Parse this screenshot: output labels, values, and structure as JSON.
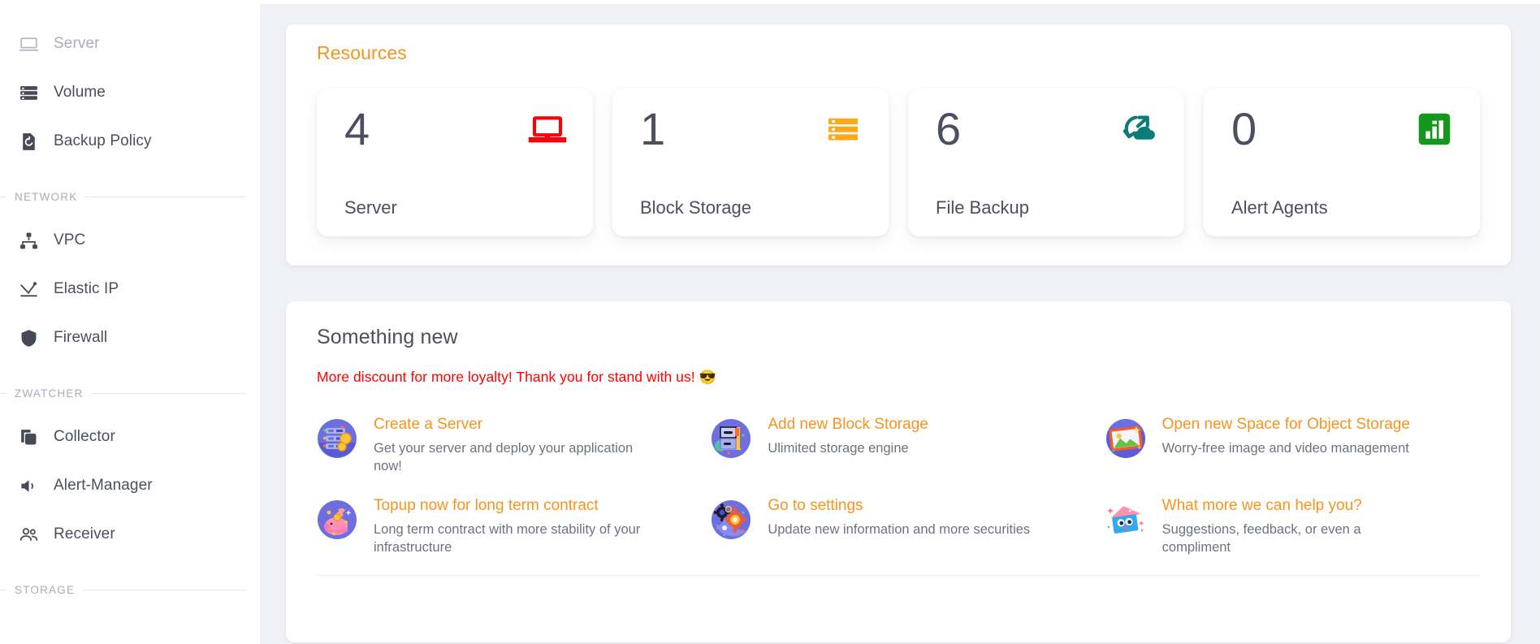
{
  "sidebar": {
    "items": [
      {
        "type": "item",
        "label": "Server",
        "icon": "laptop-icon",
        "muted": true
      },
      {
        "type": "item",
        "label": "Volume",
        "icon": "server-stack-icon",
        "muted": false
      },
      {
        "type": "item",
        "label": "Backup Policy",
        "icon": "backup-restore-icon",
        "muted": false
      },
      {
        "type": "group",
        "label": "NETWORK"
      },
      {
        "type": "item",
        "label": "VPC",
        "icon": "network-topology-icon",
        "muted": false
      },
      {
        "type": "item",
        "label": "Elastic IP",
        "icon": "elastic-ip-icon",
        "muted": false
      },
      {
        "type": "item",
        "label": "Firewall",
        "icon": "shield-icon",
        "muted": false
      },
      {
        "type": "group",
        "label": "ZWATCHER"
      },
      {
        "type": "item",
        "label": "Collector",
        "icon": "copy-layers-icon",
        "muted": false
      },
      {
        "type": "item",
        "label": "Alert-Manager",
        "icon": "speaker-icon",
        "muted": false
      },
      {
        "type": "item",
        "label": "Receiver",
        "icon": "users-icon",
        "muted": false
      },
      {
        "type": "group",
        "label": "STORAGE"
      }
    ]
  },
  "resources": {
    "title": "Resources",
    "cards": [
      {
        "value": "4",
        "label": "Server",
        "icon": "laptop-icon",
        "color": "#fb0007"
      },
      {
        "value": "1",
        "label": "Block Storage",
        "icon": "block-storage-icon",
        "color": "#ffa818"
      },
      {
        "value": "6",
        "label": "File Backup",
        "icon": "cloud-sync-icon",
        "color": "#0b7c78"
      },
      {
        "value": "0",
        "label": "Alert Agents",
        "icon": "bar-chart-icon",
        "color": "#14971d"
      }
    ]
  },
  "something_new": {
    "title": "Something new",
    "announcement": "More discount for more loyalty! Thank you for stand with us!",
    "announcement_emoji": "😎",
    "announcement_color": "#ff0000",
    "tiles": [
      {
        "title": "Create a Server",
        "desc": "Get your server and deploy your application now!",
        "icon": "server-rack-art-icon"
      },
      {
        "title": "Add new Block Storage",
        "desc": "Ulimited storage engine",
        "icon": "drawer-storage-art-icon"
      },
      {
        "title": "Open new Space for Object Storage",
        "desc": "Worry-free image and video management",
        "icon": "photo-frame-art-icon"
      },
      {
        "title": "Topup now for long term contract",
        "desc": "Long term contract with more stability of your infrastructure",
        "icon": "piggy-bank-art-icon"
      },
      {
        "title": "Go to settings",
        "desc": "Update new information and more securities",
        "icon": "gears-art-icon"
      },
      {
        "title": "What more we can help you?",
        "desc": "Suggestions, feedback, or even a compliment",
        "icon": "megaphone-box-art-icon"
      }
    ]
  },
  "theme": {
    "accent": "#f7941e",
    "content_bg": "#f1f2f7",
    "text": "#4b4f5e",
    "muted_text": "#a9adb8"
  }
}
